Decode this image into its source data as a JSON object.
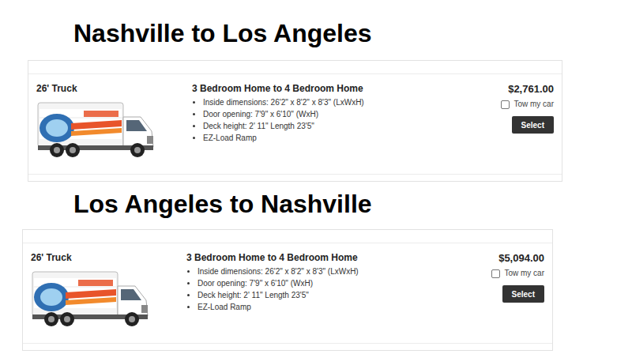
{
  "routes": [
    {
      "heading": "Nashville to Los Angeles",
      "truck": {
        "name": "26' Truck",
        "description": "3 Bedroom Home to 4 Bedroom Home",
        "specs": [
          "Inside dimensions: 26'2\" x 8'2\" x 8'3\" (LxWxH)",
          "Door opening: 7'9\" x 6'10\" (WxH)",
          "Deck height: 2' 11\" Length 23'5\"",
          "EZ-Load Ramp"
        ],
        "price": "$2,761.00",
        "tow_my_car": {
          "label": "Tow my car",
          "checked": false
        },
        "button": "Select"
      }
    },
    {
      "heading": "Los Angeles to Nashville",
      "truck": {
        "name": "26' Truck",
        "description": "3 Bedroom Home to 4 Bedroom Home",
        "specs": [
          "Inside dimensions: 26'2\" x 8'2\" x 8'3\" (LxWxH)",
          "Door opening: 7'9\" x 6'10\" (WxH)",
          "Deck height: 2' 11\" Length 23'5\"",
          "EZ-Load Ramp"
        ],
        "price": "$5,094.00",
        "tow_my_car": {
          "label": "Tow my car",
          "checked": false
        },
        "button": "Select"
      }
    }
  ]
}
